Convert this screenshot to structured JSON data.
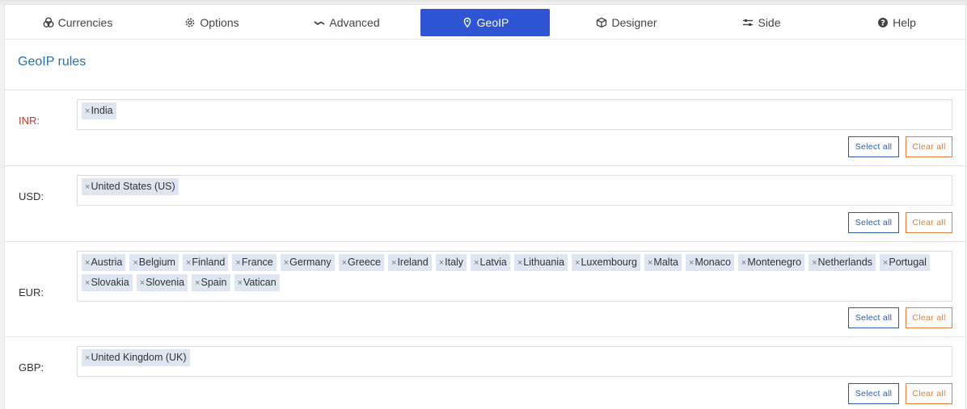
{
  "tabs": [
    {
      "label": "Currencies",
      "icon": "coins-icon"
    },
    {
      "label": "Options",
      "icon": "gear-icon"
    },
    {
      "label": "Advanced",
      "icon": "chart-line-icon"
    },
    {
      "label": "GeoIP",
      "icon": "map-pin-icon",
      "active": true
    },
    {
      "label": "Designer",
      "icon": "cube-icon"
    },
    {
      "label": "Side",
      "icon": "sliders-icon"
    },
    {
      "label": "Help",
      "icon": "question-circle-icon"
    }
  ],
  "heading": "GeoIP rules",
  "remove_glyph": "×",
  "buttons": {
    "select_all": "Select all",
    "clear_all": "Clear all"
  },
  "colors": {
    "accent": "#2f55d4",
    "heading": "#2c6fad",
    "alert": "#c0392b",
    "select_btn": "#2c5aa0",
    "clear_btn": "#e07b39",
    "chip_bg": "#dde6f1"
  },
  "rules": [
    {
      "currency": "INR:",
      "countries": [
        "India"
      ]
    },
    {
      "currency": "USD:",
      "countries": [
        "United States (US)"
      ]
    },
    {
      "currency": "EUR:",
      "countries": [
        "Austria",
        "Belgium",
        "Finland",
        "France",
        "Germany",
        "Greece",
        "Ireland",
        "Italy",
        "Latvia",
        "Lithuania",
        "Luxembourg",
        "Malta",
        "Monaco",
        "Montenegro",
        "Netherlands",
        "Portugal",
        "Slovakia",
        "Slovenia",
        "Spain",
        "Vatican"
      ]
    },
    {
      "currency": "GBP:",
      "countries": [
        "United Kingdom (UK)"
      ]
    }
  ]
}
